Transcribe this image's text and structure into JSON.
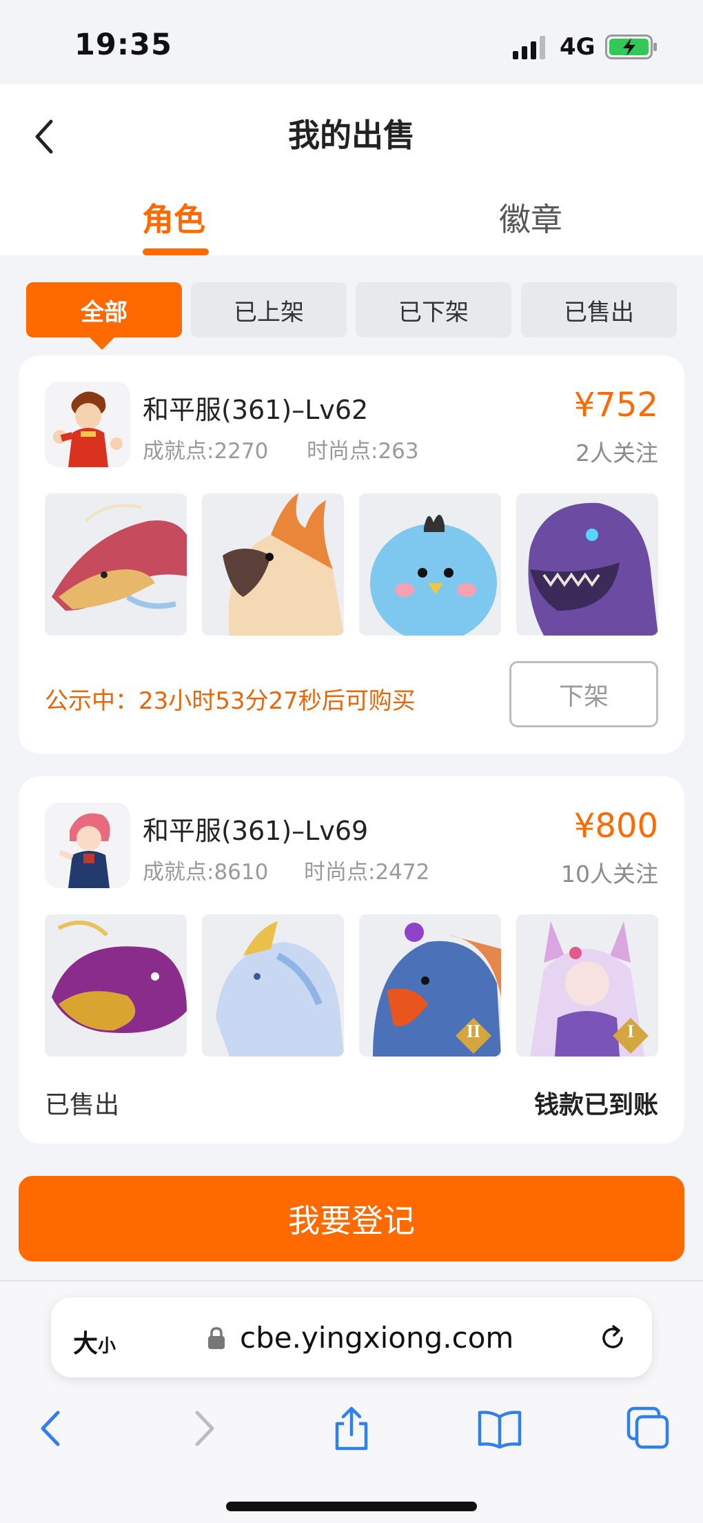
{
  "status_bar": {
    "time": "19:35",
    "network": "4G"
  },
  "header": {
    "title": "我的出售"
  },
  "tabs": [
    {
      "label": "角色",
      "active": true
    },
    {
      "label": "徽章",
      "active": false
    }
  ],
  "filters": [
    {
      "label": "全部",
      "active": true
    },
    {
      "label": "已上架",
      "active": false
    },
    {
      "label": "已下架",
      "active": false
    },
    {
      "label": "已售出",
      "active": false
    }
  ],
  "listings": [
    {
      "server": "和平服(361)–Lv62",
      "achievement": "成就点:2270",
      "fashion": "时尚点:263",
      "price": "¥752",
      "followers": "2人关注",
      "thumbs": [
        "dragon",
        "phoenix",
        "blue-bird",
        "purple-dinosaur"
      ],
      "notice": "公示中：23小时53分27秒后可购买",
      "action_label": "下架"
    },
    {
      "server": "和平服(361)–Lv69",
      "achievement": "成就点:8610",
      "fashion": "时尚点:2472",
      "price": "¥800",
      "followers": "10人关注",
      "thumbs": [
        "purple-whale",
        "ice-qilin",
        "eagle-mount",
        "fox-fairy"
      ],
      "thumb_badges": [
        "",
        "",
        "II",
        "I"
      ],
      "status": "已售出",
      "payment_status": "钱款已到账"
    }
  ],
  "register_button": "我要登记",
  "browser": {
    "text_size": "大",
    "text_size_small": "小",
    "url": "cbe.yingxiong.com"
  },
  "colors": {
    "accent": "#ff6a00",
    "background": "#f3f4f8"
  }
}
